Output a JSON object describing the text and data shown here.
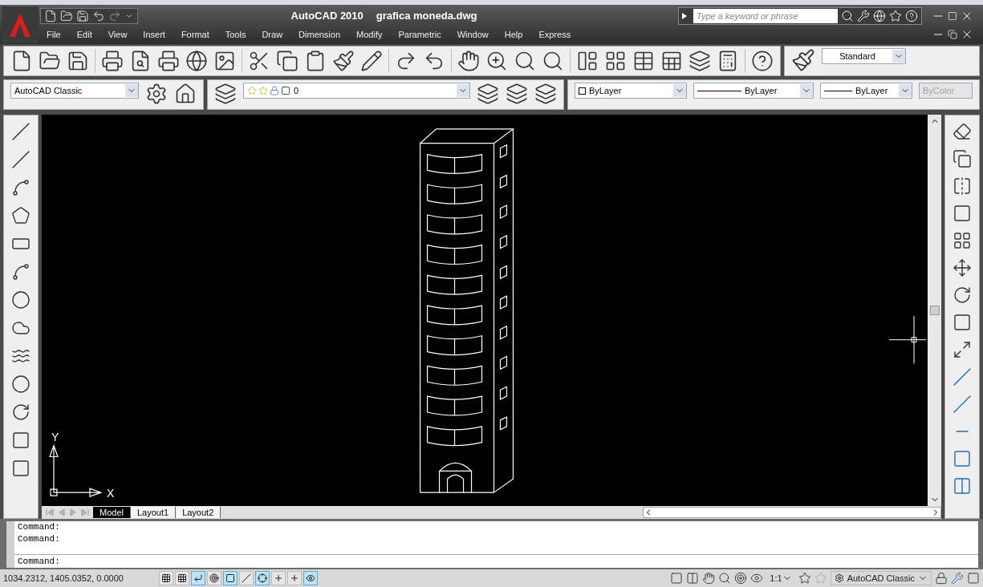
{
  "window": {
    "app_title": "AutoCAD 2010",
    "file_name": "grafica moneda.dwg"
  },
  "search": {
    "placeholder": "Type a keyword or phrase"
  },
  "menu": {
    "items": [
      "File",
      "Edit",
      "View",
      "Insert",
      "Format",
      "Tools",
      "Draw",
      "Dimension",
      "Modify",
      "Parametric",
      "Window",
      "Help",
      "Express"
    ]
  },
  "text_style": {
    "value": "Standard"
  },
  "workspace": {
    "value": "AutoCAD Classic"
  },
  "layer": {
    "value": "0"
  },
  "properties": [
    {
      "kind": "color",
      "value": "ByLayer",
      "disabled": false
    },
    {
      "kind": "linetype",
      "value": "ByLayer",
      "disabled": false
    },
    {
      "kind": "lineweight",
      "value": "ByLayer",
      "disabled": false
    },
    {
      "kind": "plotstyle",
      "value": "ByColor",
      "disabled": true
    }
  ],
  "ucs": {
    "x_label": "X",
    "y_label": "Y"
  },
  "layout_tabs": [
    {
      "label": "Model",
      "selected": true
    },
    {
      "label": "Layout1",
      "selected": false
    },
    {
      "label": "Layout2",
      "selected": false
    }
  ],
  "command_history": [
    "Command:",
    "Command:"
  ],
  "command_prompt": "Command:",
  "status_bar": {
    "coordinates": "1034.2312, 1405.0352, 0.0000",
    "toggles": [
      {
        "kind": "snap",
        "on": false
      },
      {
        "kind": "grid",
        "on": false
      },
      {
        "kind": "ortho",
        "on": true
      },
      {
        "kind": "polar",
        "on": false
      },
      {
        "kind": "osnap",
        "on": true
      },
      {
        "kind": "otrack",
        "on": false
      },
      {
        "kind": "ducs",
        "on": true
      },
      {
        "kind": "dyn",
        "on": false
      },
      {
        "kind": "lwt",
        "on": false
      },
      {
        "kind": "qp",
        "on": true
      }
    ],
    "annotation_scale": "1:1",
    "workspace": "AutoCAD Classic"
  }
}
